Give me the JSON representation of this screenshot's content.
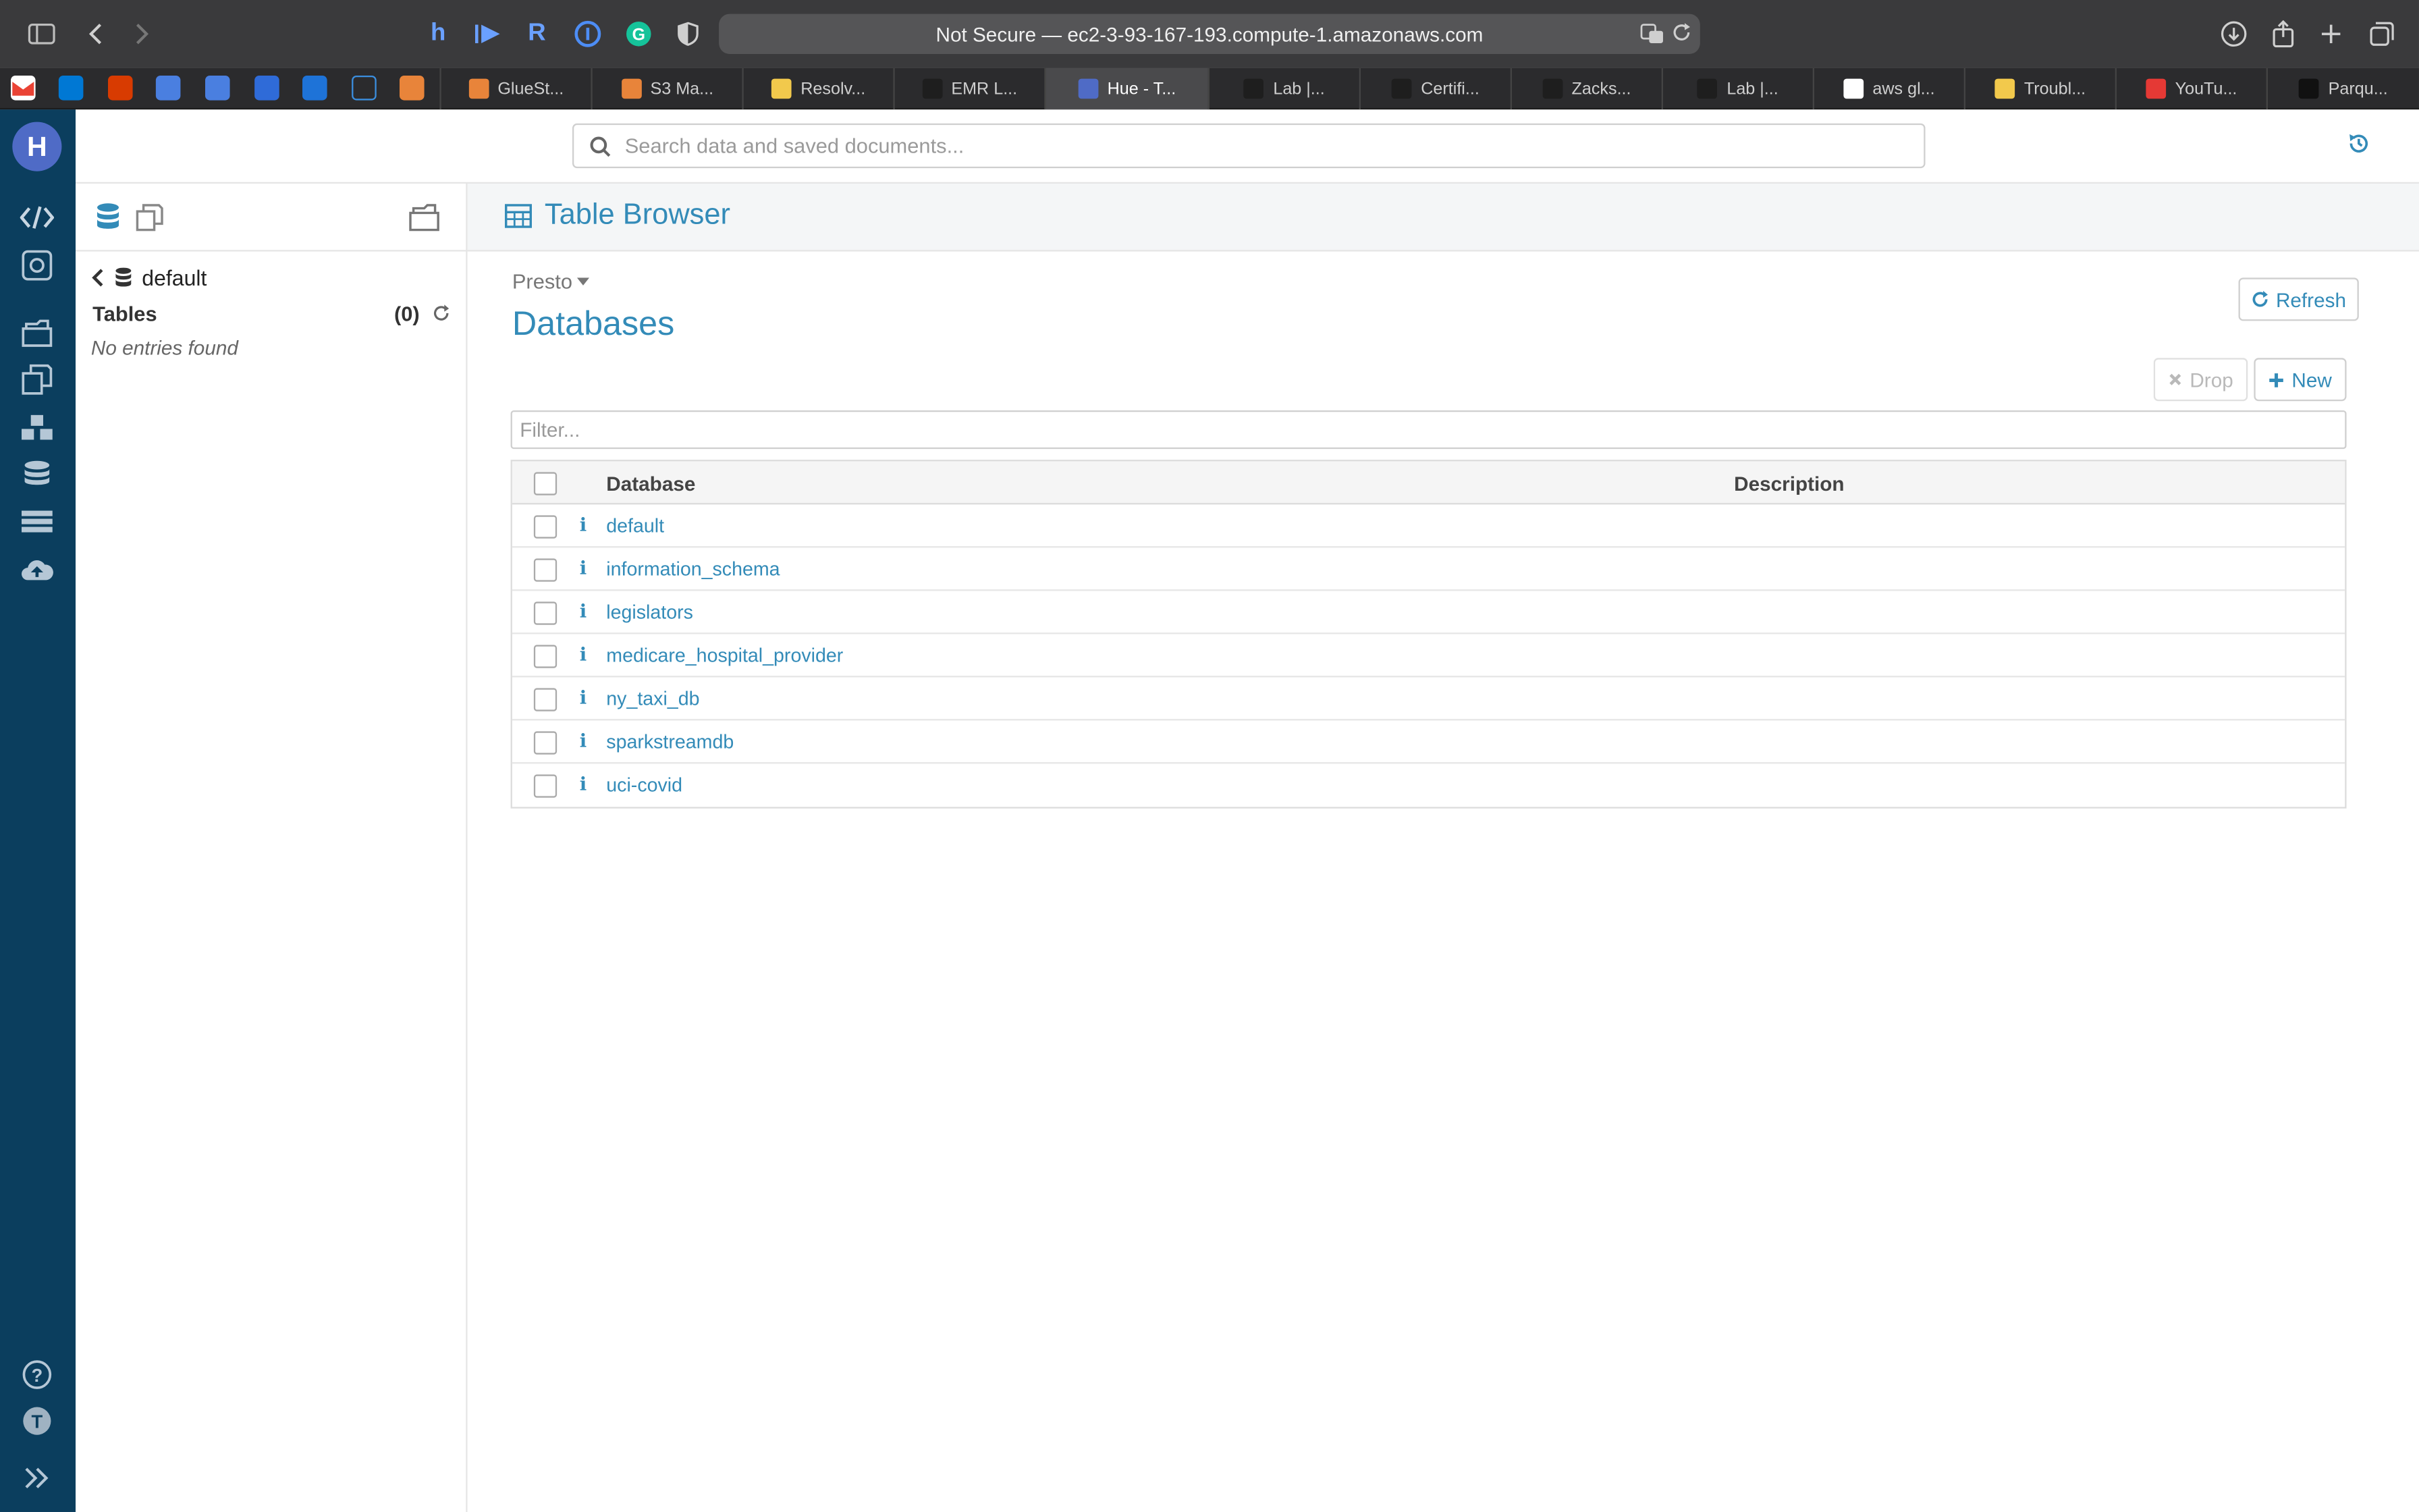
{
  "browser": {
    "url_text": "Not Secure — ec2-3-93-167-193.compute-1.amazonaws.com",
    "tabs": [
      {
        "label": "GlueSt...",
        "color": "#e8843a"
      },
      {
        "label": "S3 Ma...",
        "color": "#e8843a"
      },
      {
        "label": "Resolv...",
        "color": "#f2c94c"
      },
      {
        "label": "EMR L...",
        "color": "#1e1e1e"
      },
      {
        "label": "Hue - T...",
        "color": "#4f6bc6"
      },
      {
        "label": "Lab |...",
        "color": "#1e1e1e"
      },
      {
        "label": "Certifi...",
        "color": "#1e1e1e"
      },
      {
        "label": "Zacks...",
        "color": "#1e1e1e"
      },
      {
        "label": "Lab |...",
        "color": "#1e1e1e"
      },
      {
        "label": "aws gl...",
        "color": "#ffffff"
      },
      {
        "label": "Troubl...",
        "color": "#f2c94c"
      },
      {
        "label": "YouTu...",
        "color": "#e53935"
      },
      {
        "label": "Parqu...",
        "color": "#111111"
      }
    ],
    "active_tab_index": 4
  },
  "search": {
    "placeholder": "Search data and saved documents..."
  },
  "assist": {
    "database": "default",
    "tables_label": "Tables",
    "tables_count": "(0)",
    "empty_text": "No entries found"
  },
  "main": {
    "title": "Table Browser",
    "engine": "Presto",
    "heading": "Databases",
    "refresh_label": "Refresh",
    "drop_label": "Drop",
    "new_label": "New",
    "filter_placeholder": "Filter...",
    "columns": {
      "database": "Database",
      "description": "Description"
    },
    "databases": [
      "default",
      "information_schema",
      "legislators",
      "medicare_hospital_provider",
      "ny_taxi_db",
      "sparkstreamdb",
      "uci-covid"
    ]
  },
  "colors": {
    "accent": "#338bb8",
    "nav_bg": "#0b3e5e",
    "browser_chrome": "#3a3a3c"
  }
}
